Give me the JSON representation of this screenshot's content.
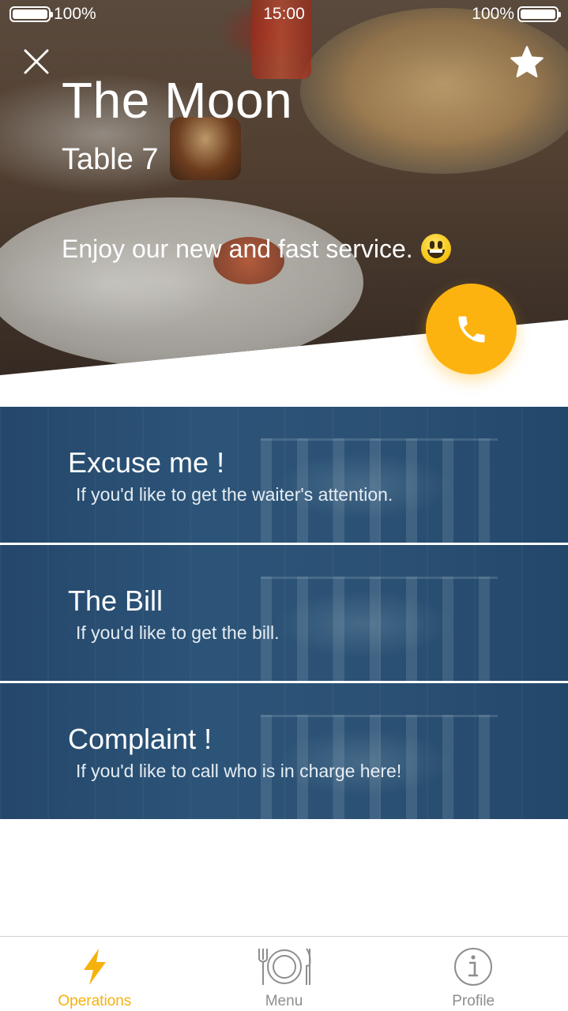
{
  "status_bar": {
    "left_battery": "100%",
    "time": "15:00",
    "right_battery": "100%"
  },
  "header": {
    "restaurant_name": "The Moon",
    "table": "Table 7",
    "tagline": "Enjoy our new and fast service.",
    "tagline_emoji": "smiley-emoji",
    "close_icon": "close-icon",
    "favorite_icon": "star-icon",
    "call_icon": "phone-icon"
  },
  "actions": [
    {
      "title": "Excuse me !",
      "description": "If you'd like to get the waiter's attention."
    },
    {
      "title": "The Bill",
      "description": "If you'd like to get the bill."
    },
    {
      "title": "Complaint !",
      "description": "If you'd like to call who is in charge here!"
    }
  ],
  "tabs": [
    {
      "label": "Operations",
      "icon": "lightning-icon",
      "active": true
    },
    {
      "label": "Menu",
      "icon": "plate-cutlery-icon",
      "active": false
    },
    {
      "label": "Profile",
      "icon": "info-icon",
      "active": false
    }
  ],
  "colors": {
    "accent": "#fdb30f",
    "card_blue": "#2b5174",
    "tab_inactive": "#8e8e8e"
  }
}
